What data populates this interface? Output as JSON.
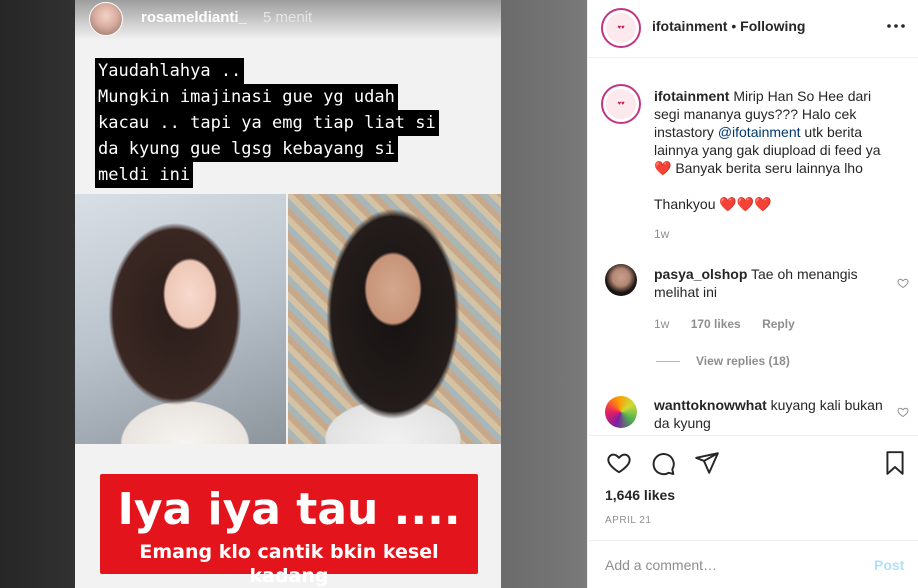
{
  "story": {
    "username": "rosameldianti_",
    "time": "5 menit",
    "text_lines": [
      "Yaudahlahya ..",
      "Mungkin imajinasi gue yg udah",
      "kacau .. tapi ya emg tiap liat si",
      "da kyung gue lgsg kebayang si",
      "meldi ini"
    ],
    "banner_title": "Iya iya tau ....",
    "banner_sub": "Emang klo cantik bkin kesel kadang",
    "banner_color": "#e4141c"
  },
  "header": {
    "username": "ifotainment",
    "separator": "•",
    "follow_status": "Following",
    "more_icon": "more-horizontal-icon"
  },
  "caption": {
    "username": "ifotainment",
    "text_before_mention": "Mirip Han So Hee dari segi mananya guys??? Halo cek instastory",
    "mention": "@ifotainment",
    "text_after_mention": "utk berita lainnya yang gak diupload di feed ya ❤️ Banyak berita seru lainnya lho",
    "thanks": "Thankyou ❤️❤️❤️",
    "age": "1w"
  },
  "comments": [
    {
      "username": "pasya_olshop",
      "text": "Tae oh menangis melihat ini",
      "age": "1w",
      "likes": "170 likes",
      "reply_label": "Reply",
      "view_replies": "View replies (18)"
    },
    {
      "username": "wanttoknowwhat",
      "text": "kuyang kali bukan da kyung"
    }
  ],
  "actions": {
    "icons": [
      "heart-icon",
      "comment-icon",
      "share-icon",
      "bookmark-icon"
    ],
    "likes": "1,646 likes",
    "date": "APRIL 21"
  },
  "add_comment": {
    "placeholder": "Add a comment…",
    "post_label": "Post"
  },
  "colors": {
    "text": "#262626",
    "muted": "#8e8e8e",
    "link": "#00376b",
    "post_disabled": "#b2dffc",
    "ring": "#c13584"
  }
}
